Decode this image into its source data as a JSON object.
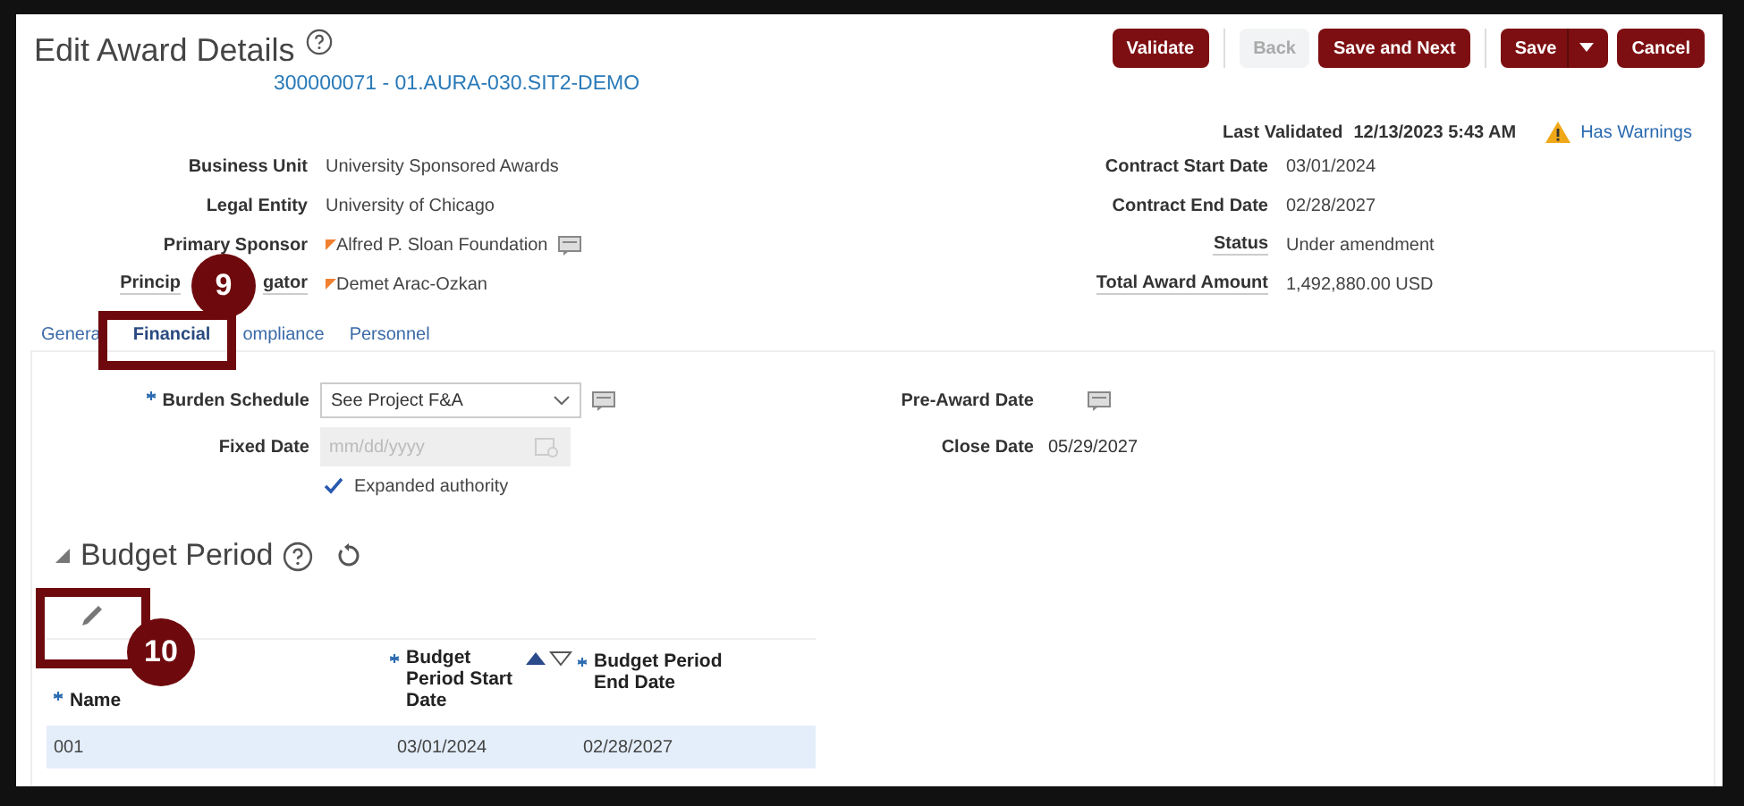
{
  "page": {
    "title": "Edit Award Details",
    "record_link": "300000071 - 01.AURA-030.SIT2-DEMO"
  },
  "buttons": [
    {
      "label": "Validate",
      "kind": "primary",
      "disabled": false
    },
    {
      "label": "Back",
      "kind": "plain",
      "disabled": true
    },
    {
      "label": "Save and Next",
      "kind": "primary",
      "disabled": false
    },
    {
      "label": "Save",
      "kind": "split",
      "disabled": false
    },
    {
      "label": "Cancel",
      "kind": "primary",
      "disabled": false
    }
  ],
  "validation": {
    "label": "Last Validated",
    "value": "12/13/2023 5:43 AM",
    "warning": "Has Warnings"
  },
  "fields_left": [
    {
      "label_parts": [
        "Business Unit"
      ],
      "value": "University Sponsored Awards",
      "flagged": false,
      "note": false,
      "underlined": false
    },
    {
      "label_parts": [
        "Legal Entity"
      ],
      "value": "University of Chicago",
      "flagged": false,
      "note": false,
      "underlined": false
    },
    {
      "label_parts": [
        "Primary Sponsor"
      ],
      "value": "Alfred P. Sloan Foundation",
      "flagged": true,
      "note": true,
      "underlined": false
    },
    {
      "label_parts": [
        "Princip",
        "gator"
      ],
      "value": "Demet Arac-Ozkan",
      "flagged": true,
      "note": false,
      "underlined": true
    }
  ],
  "fields_right": [
    {
      "label": "Contract Start Date",
      "value": "03/01/2024",
      "underlined": false
    },
    {
      "label": "Contract End Date",
      "value": "02/28/2027",
      "underlined": false
    },
    {
      "label": "Status",
      "value": "Under amendment",
      "underlined": true
    },
    {
      "label": "Total Award Amount",
      "value": "1,492,880.00  USD",
      "underlined": true
    }
  ],
  "tabs": [
    {
      "label": "Genera",
      "selected": false
    },
    {
      "label": "Financial",
      "selected": true
    },
    {
      "label": "ompliance",
      "selected": false
    },
    {
      "label": "Personnel",
      "selected": false
    }
  ],
  "financial": {
    "burden_schedule": {
      "label": "Burden Schedule",
      "required": true,
      "value": "See Project F&A"
    },
    "fixed_date": {
      "label": "Fixed Date",
      "placeholder": "mm/dd/yyyy",
      "disabled": true
    },
    "expanded_authority": {
      "label": "Expanded authority",
      "checked": true
    },
    "pre_award_date": {
      "label": "Pre-Award Date"
    },
    "close_date": {
      "label": "Close Date",
      "value": "05/29/2027"
    }
  },
  "budget_period": {
    "title": "Budget Period",
    "expanded": true,
    "columns": [
      {
        "label": "Name",
        "required": true,
        "sortable": false
      },
      {
        "label": "Budget Period Start Date",
        "required": true,
        "sortable": true
      },
      {
        "label": "Budget Period End Date",
        "required": true,
        "sortable": false
      }
    ],
    "rows": [
      {
        "cells": [
          "001",
          "03/01/2024",
          "02/28/2027"
        ],
        "selected": true
      }
    ]
  },
  "callouts": [
    {
      "number": "9"
    },
    {
      "number": "10"
    }
  ]
}
